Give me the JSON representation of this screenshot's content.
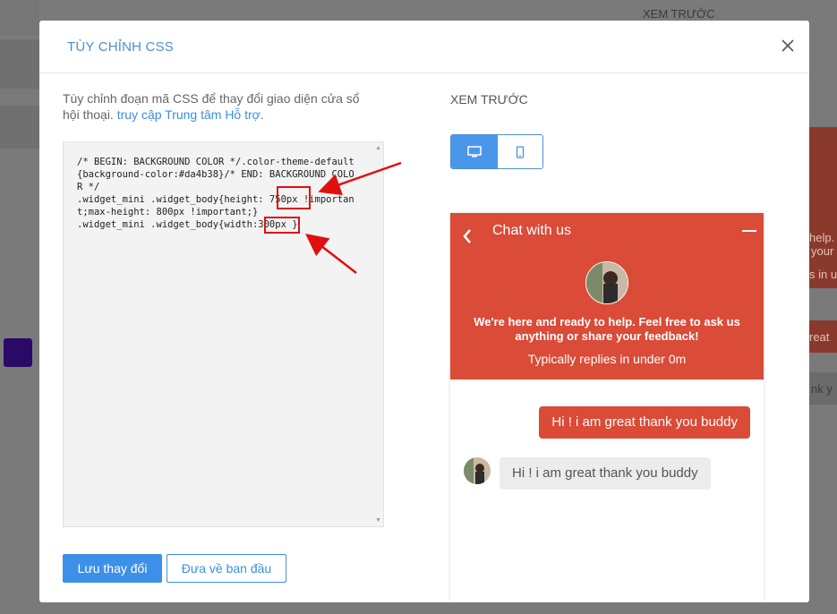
{
  "background": {
    "preview_label": "XEM TRƯỚC",
    "fragments": [
      "help.",
      "your",
      "s in u",
      "reat",
      "nk y"
    ]
  },
  "modal": {
    "title": "TÙY CHỈNH CSS",
    "description_prefix": "Tùy chỉnh đoạn mã CSS để thay đổi giao diện cửa sổ hội thoại. ",
    "description_link": "truy cập Trung tâm Hỗ trợ",
    "description_suffix": ".",
    "css_code": "/* BEGIN: BACKGROUND COLOR */.color-theme-default{background-color:#da4b38}/* END: BACKGROUND COLOR */\n.widget_mini .widget_body{height: 750px !important;max-height: 800px !important;}\n.widget_mini .widget_body{width:300px }",
    "save_label": "Lưu thay đổi",
    "reset_label": "Đưa về ban đầu",
    "preview_label": "XEM TRƯỚC"
  },
  "widget": {
    "title": "Chat with us",
    "welcome": "We're here and ready to help. Feel free to ask us anything or share your feedback!",
    "reply_time": "Typically replies in under 0m",
    "sent_message": "Hi ! i am great thank you buddy",
    "received_message": "Hi ! i am great thank you buddy"
  },
  "colors": {
    "accent": "#4a90d9",
    "widget_theme": "#da4b38",
    "highlight": "#e01010"
  },
  "icons": {
    "close": "close-icon",
    "desktop": "desktop-icon",
    "mobile": "mobile-icon",
    "back": "chevron-left-icon",
    "minimize": "minimize-icon"
  }
}
